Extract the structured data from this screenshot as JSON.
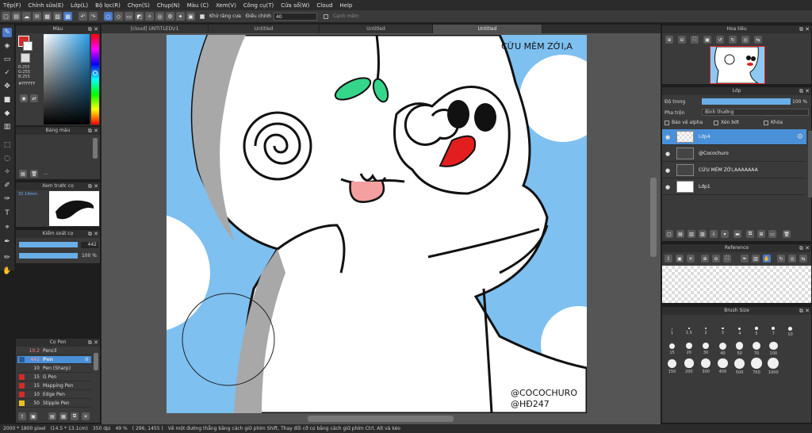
{
  "menu": [
    "Tệp(F)",
    "Chỉnh sửa(E)",
    "Lớp(L)",
    "Bộ lọc(R)",
    "Chọn(S)",
    "Chụp(N)",
    "Màu (C)",
    "Xem(V)",
    "Công cụ(T)",
    "Cửa sổ(W)",
    "Cloud",
    "Help"
  ],
  "toolbar": {
    "antialias_label": "Khử răng cưa",
    "adjust_label": "Điều chỉnh",
    "adjust_value": "40",
    "edge_label": "Cạnh mềm"
  },
  "color_panel": {
    "title": "Màu",
    "r": "R:255",
    "g": "G:255",
    "b": "B:255",
    "hex": "#FFFFFF"
  },
  "palette_panel": {
    "title": "Bảng màu",
    "more": "..."
  },
  "brush_preview": {
    "title": "Xem trước cọ",
    "size": "32.14mm"
  },
  "brush_control": {
    "title": "Kiểm soát cọ",
    "size_value": "442",
    "opacity_value": "100 %"
  },
  "brush_panel": {
    "title": "Cọ Pen",
    "items": [
      {
        "size": "10.2",
        "name": "Pencil",
        "color": "#3a3a3a"
      },
      {
        "size": "442",
        "name": "Pen",
        "color": "#2a5a9a"
      },
      {
        "size": "10",
        "name": "Pen (Sharp)",
        "color": "#3a3a3a"
      },
      {
        "size": "15",
        "name": "G Pen",
        "color": "#d42a2a"
      },
      {
        "size": "15",
        "name": "Mapping Pen",
        "color": "#d42a2a"
      },
      {
        "size": "10",
        "name": "Edge Pen",
        "color": "#d42a2a"
      },
      {
        "size": "50",
        "name": "Stipple Pen",
        "color": "#e8c020"
      }
    ]
  },
  "tabs": [
    "[cloud] UNTITLED\\r1",
    "Untitled",
    "Untitled",
    "Untitled"
  ],
  "artwork": {
    "title_text": "CỪU MÈM ZỚI,A",
    "credit1": "@COCOCHURO",
    "credit2": "@HĐ247"
  },
  "navigator": {
    "title": "Hoa tiêu"
  },
  "layer_panel": {
    "title": "Lớp",
    "opacity_label": "Độ trong",
    "opacity_value": "100 %",
    "opacity_fraction": 1.0,
    "blend_label": "Pha trộn",
    "blend_value": "Bình thường",
    "protect_alpha": "Bảo vệ alpha",
    "clipping": "Xén bớt",
    "lock": "Khóa",
    "layers": [
      {
        "name": "Lớp4",
        "selected": true
      },
      {
        "name": "@Cocochuro",
        "selected": false
      },
      {
        "name": "CỪU MÈM ZỚI,AAAAAAA",
        "selected": false
      },
      {
        "name": "Lớp1",
        "selected": false
      }
    ]
  },
  "reference_panel": {
    "title": "Reference"
  },
  "brush_size_panel": {
    "title": "Brush Size",
    "sizes": [
      "1",
      "1.5",
      "2",
      "3",
      "4",
      "5",
      "7",
      "10",
      "15",
      "20",
      "30",
      "40",
      "50",
      "70",
      "100",
      "150",
      "200",
      "300",
      "400",
      "500",
      "700",
      "1000"
    ]
  },
  "status": {
    "dims": "2000 * 1800 pixel",
    "cm": "(14.5 * 13.1cm)",
    "dpi": "350 dpi",
    "zoom": "49 %",
    "coords": "( 296, 1455 )",
    "hint": "Vẽ một đường thẳng bằng cách giữ phím Shift, Thay đổi cỡ cọ bằng cách giữ phím Ctrl, Alt và kéo"
  }
}
